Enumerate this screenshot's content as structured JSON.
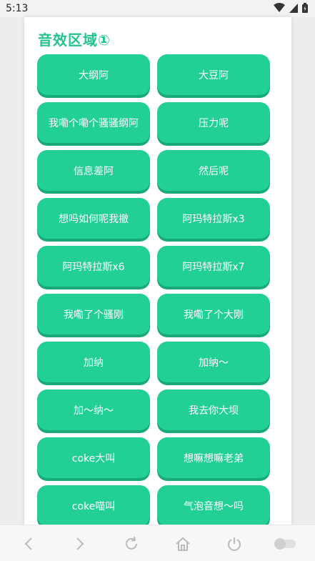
{
  "status_bar": {
    "time": "5:13"
  },
  "section": {
    "title": "音效区域①"
  },
  "buttons": [
    "大纲阿",
    "大豆阿",
    "我嘞个嘞个骚骚纲阿",
    "压力呢",
    "信息差阿",
    "然后呢",
    "想吗如何呢我撤",
    "阿玛特拉斯x3",
    "阿玛特拉斯x6",
    "阿玛特拉斯x7",
    "我嘞了个骚刚",
    "我嘞了个大刚",
    "加纳",
    "加纳～",
    "加～纳～",
    "我去你大坝",
    "coke大叫",
    "想嘛想嘛老弟",
    "coke喵叫",
    "气泡音想～吗"
  ],
  "colors": {
    "accent": "#22c38e",
    "button_bg": "#22d093",
    "button_shadow": "#18a976"
  },
  "nav_icons": [
    "back-icon",
    "forward-icon",
    "refresh-icon",
    "home-icon",
    "power-icon",
    "toggle-icon"
  ]
}
